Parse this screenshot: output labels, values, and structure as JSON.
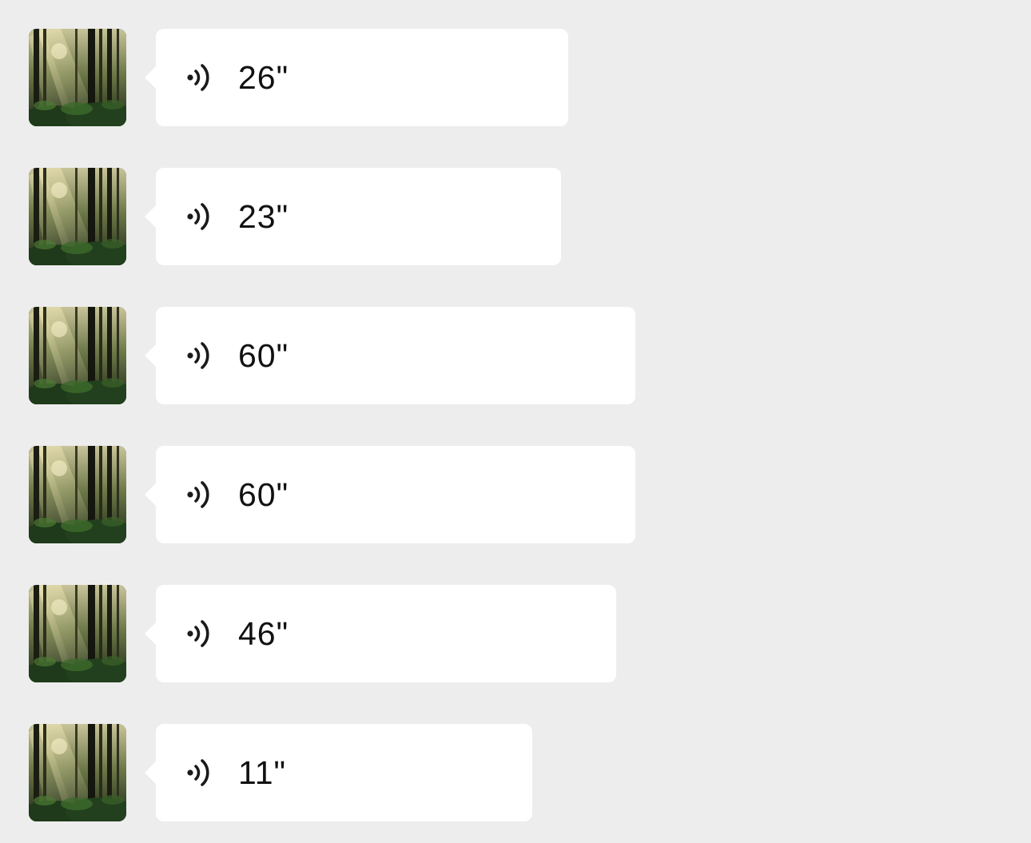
{
  "messages": [
    {
      "duration_label": "26\"",
      "duration_seconds": 26
    },
    {
      "duration_label": "23\"",
      "duration_seconds": 23
    },
    {
      "duration_label": "60\"",
      "duration_seconds": 60
    },
    {
      "duration_label": "60\"",
      "duration_seconds": 60
    },
    {
      "duration_label": "46\"",
      "duration_seconds": 46
    },
    {
      "duration_label": "11\"",
      "duration_seconds": 11
    }
  ],
  "icons": {
    "voice": "voice-wave-icon",
    "avatar": "forest-avatar"
  },
  "colors": {
    "background": "#ededed",
    "bubble": "#ffffff",
    "text": "#111111"
  }
}
